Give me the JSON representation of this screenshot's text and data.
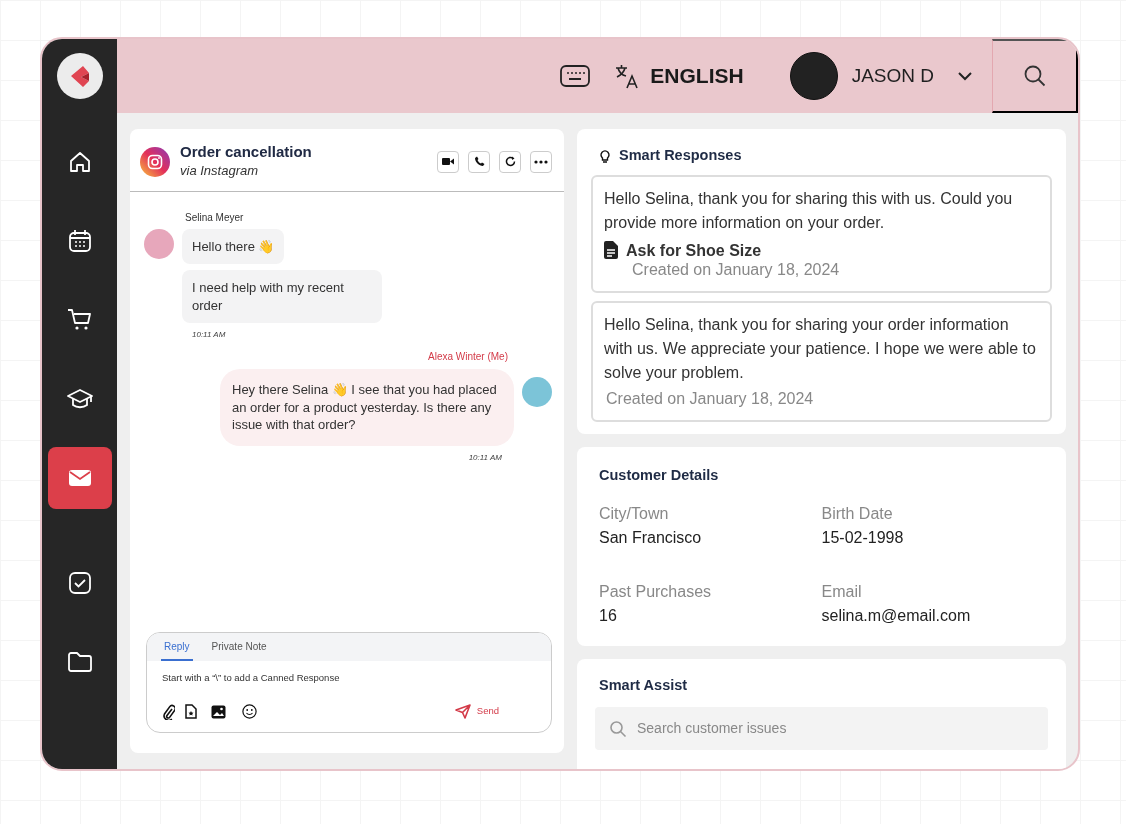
{
  "sidebar": {
    "items": [
      {
        "selected": false
      },
      {
        "selected": false
      },
      {
        "selected": false
      },
      {
        "selected": false
      },
      {
        "selected": true
      },
      {
        "selected": false
      },
      {
        "selected": false
      }
    ]
  },
  "header": {
    "language": "ENGLISH",
    "user": "JASON D"
  },
  "conversation": {
    "title": "Order cancellation",
    "channel": "via Instagram",
    "messages": [
      {
        "kind": "incoming",
        "sender": "Selina Meyer",
        "bubbles": [
          "Hello there 👋",
          "I need help with my recent order"
        ],
        "time": "10:11 AM"
      },
      {
        "kind": "outgoing",
        "sender": "Alexa Winter (Me)",
        "bubbles": [
          "Hey there Selina 👋 I see that you had placed an order for a product yesterday. Is there any issue with that order?"
        ],
        "time": "10:11 AM"
      }
    ],
    "composer": {
      "tabs": [
        {
          "label": "Reply",
          "selected": true
        },
        {
          "label": "Private Note",
          "selected": false
        }
      ],
      "placeholder": "Start with a “\\” to add a Canned Response",
      "send": "Send"
    }
  },
  "smart_responses": {
    "title": "Smart Responses",
    "items": [
      {
        "text": "Hello Selina, thank you for sharing this with us. Could you provide more information on your order.",
        "action": "Ask for Shoe Size",
        "created": "Created on January 18, 2024"
      },
      {
        "text": "Hello Selina, thank you for sharing your order information with us. We appreciate your patience. I hope we were able to solve your problem.",
        "created": "Created on January 18, 2024"
      }
    ]
  },
  "customer_details": {
    "title": "Customer Details",
    "fields": [
      {
        "label": "City/Town",
        "value": "San Francisco"
      },
      {
        "label": "Birth Date",
        "value": "15-02-1998"
      },
      {
        "label": "Past Purchases",
        "value": "16"
      },
      {
        "label": "Email",
        "value": "selina.m@email.com"
      }
    ]
  },
  "smart_assist": {
    "title": "Smart Assist",
    "placeholder": "Search customer issues"
  }
}
